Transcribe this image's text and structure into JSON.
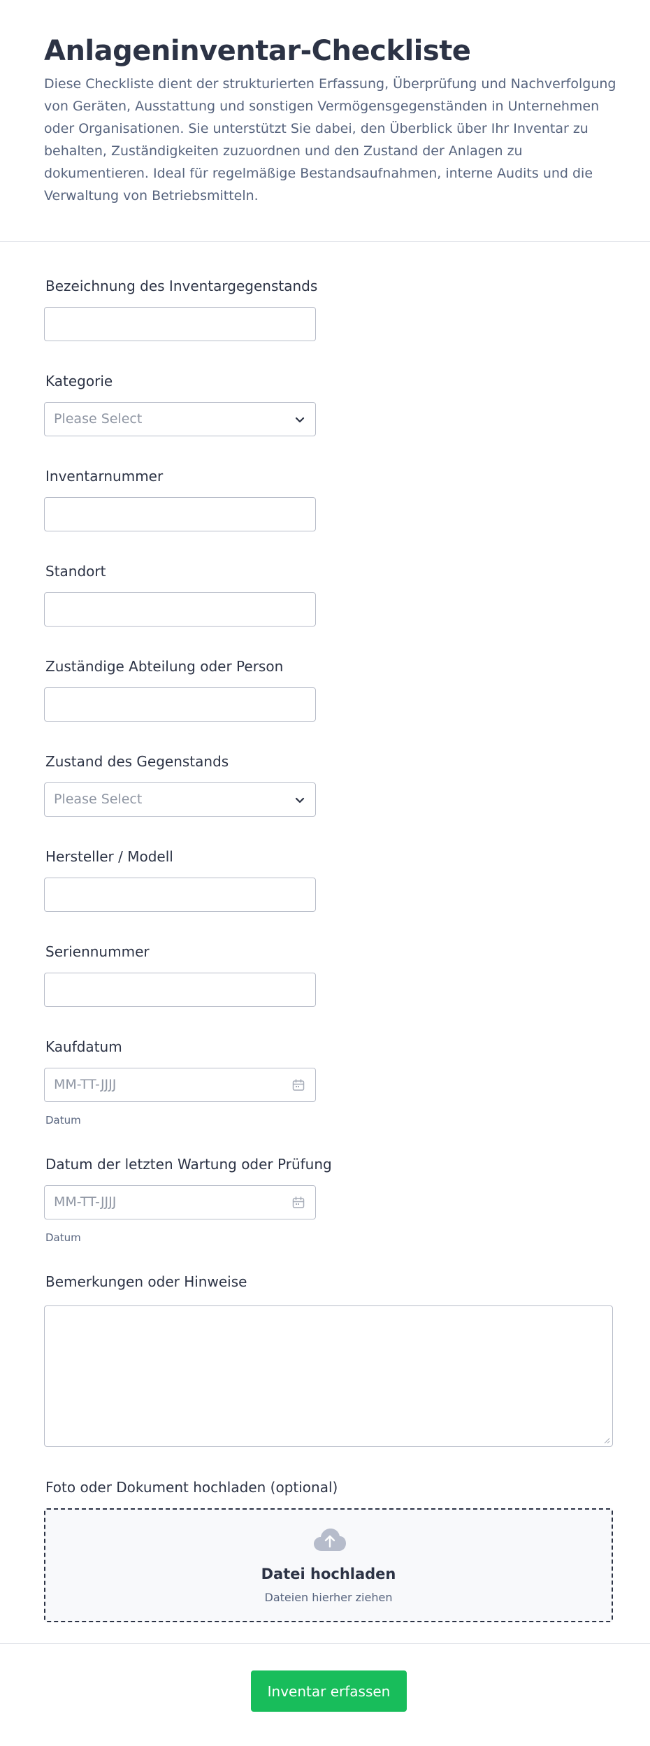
{
  "header": {
    "title": "Anlageninventar-Checkliste",
    "description": "Diese Checkliste dient der strukturierten Erfassung, Überprüfung und Nachverfolgung von Geräten, Ausstattung und sonstigen Vermögensgegenständen in Unternehmen oder Organisationen. Sie unterstützt Sie dabei, den Überblick über Ihr Inventar zu behalten, Zuständigkeiten zuzuordnen und den Zustand der Anlagen zu dokumentieren. Ideal für regelmäßige Bestandsaufnahmen, interne Audits und die Verwaltung von Betriebsmitteln."
  },
  "fields": {
    "bezeichnung": {
      "label": "Bezeichnung des Inventargegenstands",
      "value": ""
    },
    "kategorie": {
      "label": "Kategorie",
      "placeholder": "Please Select"
    },
    "inventarnummer": {
      "label": "Inventarnummer",
      "value": ""
    },
    "standort": {
      "label": "Standort",
      "value": ""
    },
    "zustaendig": {
      "label": "Zuständige Abteilung oder Person",
      "value": ""
    },
    "zustand": {
      "label": "Zustand des Gegenstands",
      "placeholder": "Please Select"
    },
    "hersteller": {
      "label": "Hersteller / Modell",
      "value": ""
    },
    "seriennummer": {
      "label": "Seriennummer",
      "value": ""
    },
    "kaufdatum": {
      "label": "Kaufdatum",
      "placeholder": "MM-TT-JJJJ",
      "sublabel": "Datum"
    },
    "wartung": {
      "label": "Datum der letzten Wartung oder Prüfung",
      "placeholder": "MM-TT-JJJJ",
      "sublabel": "Datum"
    },
    "bemerkungen": {
      "label": "Bemerkungen oder Hinweise",
      "value": ""
    },
    "upload": {
      "label": "Foto oder Dokument hochladen (optional)",
      "title": "Datei hochladen",
      "subtitle": "Dateien hierher ziehen"
    }
  },
  "icons": {
    "select": "chevron-down-icon",
    "date": "calendar-icon",
    "upload": "cloud-upload-icon"
  },
  "footer": {
    "submit_label": "Inventar erfassen"
  },
  "colors": {
    "accent": "#18bd5b",
    "text": "#2c3345",
    "muted": "#57647e",
    "border": "#b8bdc9"
  }
}
